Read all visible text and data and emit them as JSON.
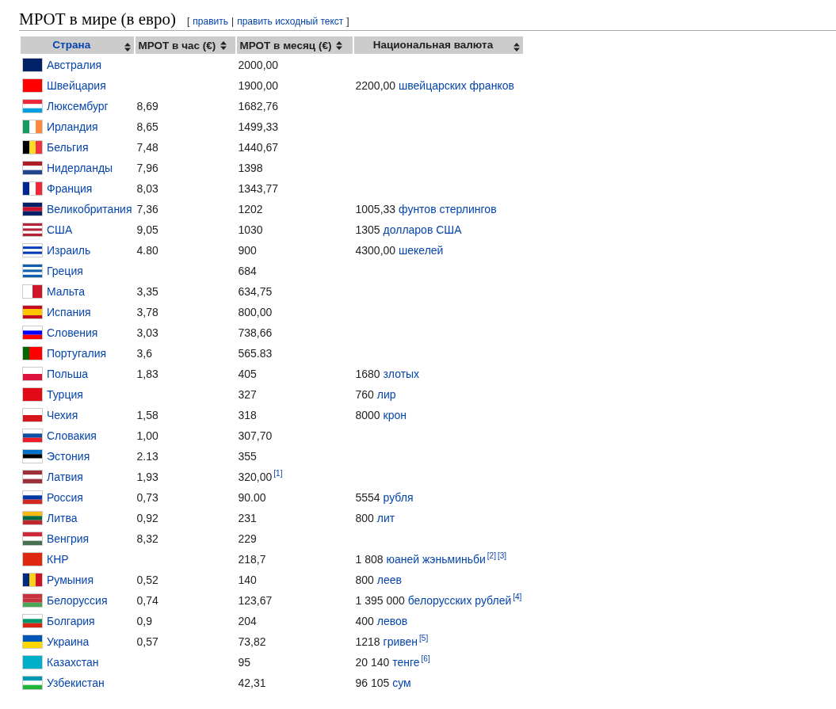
{
  "heading": "МРОТ в мире (в евро)",
  "edit_links": {
    "open": "[",
    "items": [
      "править",
      "править исходный текст"
    ],
    "separator": "|",
    "close": "]"
  },
  "table": {
    "columns": [
      {
        "label": "Страна",
        "link": true
      },
      {
        "label": "МРОТ в час (€)",
        "link": false
      },
      {
        "label": "МРОТ в месяц (€)",
        "link": false
      },
      {
        "label": "Национальная валюта",
        "link": false
      }
    ],
    "rows": [
      {
        "country": "Австралия",
        "flag": {
          "kind": "horizontal",
          "stripes": [
            {
              "color": "#012169"
            }
          ]
        },
        "monthly": "2000,00"
      },
      {
        "country": "Швейцария",
        "flag": {
          "kind": "horizontal",
          "stripes": [
            {
              "color": "#ff0000"
            }
          ]
        },
        "monthly": "1900,00",
        "currency": {
          "amount": "2200,00",
          "unit": "швейцарских франков"
        }
      },
      {
        "country": "Люксембург",
        "flag": {
          "kind": "horizontal",
          "stripes": [
            {
              "color": "#ed2939"
            },
            {
              "color": "#ffffff"
            },
            {
              "color": "#00a1de"
            }
          ]
        },
        "hourly": "8,69",
        "monthly": "1682,76"
      },
      {
        "country": "Ирландия",
        "flag": {
          "kind": "vertical",
          "stripes": [
            {
              "color": "#169b62"
            },
            {
              "color": "#ffffff"
            },
            {
              "color": "#ff883e"
            }
          ]
        },
        "hourly": "8,65",
        "monthly": "1499,33"
      },
      {
        "country": "Бельгия",
        "flag": {
          "kind": "vertical",
          "stripes": [
            {
              "color": "#000000"
            },
            {
              "color": "#fdda24"
            },
            {
              "color": "#ef3340"
            }
          ]
        },
        "hourly": "7,48",
        "monthly": "1440,67"
      },
      {
        "country": "Нидерланды",
        "flag": {
          "kind": "horizontal",
          "stripes": [
            {
              "color": "#ae1c28"
            },
            {
              "color": "#ffffff"
            },
            {
              "color": "#21468b"
            }
          ]
        },
        "hourly": "7,96",
        "monthly": "1398"
      },
      {
        "country": "Франция",
        "flag": {
          "kind": "vertical",
          "stripes": [
            {
              "color": "#002395"
            },
            {
              "color": "#ffffff"
            },
            {
              "color": "#ed2939"
            }
          ]
        },
        "hourly": "8,03",
        "monthly": "1343,77"
      },
      {
        "country": "Великобритания",
        "flag": {
          "kind": "horizontal",
          "stripes": [
            {
              "color": "#012169"
            },
            {
              "color": "#c8102e"
            },
            {
              "color": "#012169"
            }
          ]
        },
        "hourly": "7,36",
        "monthly": "1202",
        "currency": {
          "amount": "1005,33",
          "unit": "фунтов стерлингов"
        }
      },
      {
        "country": "США",
        "flag": {
          "kind": "horizontal",
          "stripes": [
            {
              "color": "#b22234"
            },
            {
              "color": "#ffffff"
            },
            {
              "color": "#b22234"
            },
            {
              "color": "#ffffff"
            },
            {
              "color": "#b22234"
            }
          ]
        },
        "hourly": "9,05",
        "monthly": "1030",
        "currency": {
          "amount": "1305",
          "unit": "долларов США"
        }
      },
      {
        "country": "Израиль",
        "flag": {
          "kind": "horizontal",
          "stripes": [
            {
              "color": "#ffffff"
            },
            {
              "color": "#0038b8"
            },
            {
              "color": "#ffffff"
            },
            {
              "color": "#0038b8"
            },
            {
              "color": "#ffffff"
            }
          ]
        },
        "hourly": "4.80",
        "monthly": "900",
        "currency": {
          "amount": "4300,00",
          "unit": "шекелей"
        }
      },
      {
        "country": "Греция",
        "flag": {
          "kind": "horizontal",
          "stripes": [
            {
              "color": "#0d5eaf"
            },
            {
              "color": "#ffffff"
            },
            {
              "color": "#0d5eaf"
            },
            {
              "color": "#ffffff"
            },
            {
              "color": "#0d5eaf"
            }
          ]
        },
        "monthly": "684"
      },
      {
        "country": "Мальта",
        "flag": {
          "kind": "vertical",
          "stripes": [
            {
              "color": "#ffffff"
            },
            {
              "color": "#cf142b"
            }
          ]
        },
        "hourly": "3,35",
        "monthly": "634,75"
      },
      {
        "country": "Испания",
        "flag": {
          "kind": "horizontal",
          "stripes": [
            {
              "color": "#c60b1e"
            },
            {
              "color": "#ffc400"
            },
            {
              "color": "#ffc400"
            },
            {
              "color": "#c60b1e"
            }
          ]
        },
        "hourly": "3,78",
        "monthly": "800,00"
      },
      {
        "country": "Словения",
        "flag": {
          "kind": "horizontal",
          "stripes": [
            {
              "color": "#ffffff"
            },
            {
              "color": "#0000ff"
            },
            {
              "color": "#ff0000"
            }
          ]
        },
        "hourly": "3,03",
        "monthly": "738,66"
      },
      {
        "country": "Португалия",
        "flag": {
          "kind": "vertical",
          "stripes": [
            {
              "color": "#006600"
            },
            {
              "color": "#ff0000"
            },
            {
              "color": "#ff0000"
            }
          ]
        },
        "hourly": "3,6",
        "monthly": "565.83"
      },
      {
        "country": "Польша",
        "flag": {
          "kind": "horizontal",
          "stripes": [
            {
              "color": "#ffffff"
            },
            {
              "color": "#dc143c"
            }
          ]
        },
        "hourly": "1,83",
        "monthly": "405",
        "currency": {
          "amount": "1680",
          "unit": "злотых"
        }
      },
      {
        "country": "Турция",
        "flag": {
          "kind": "horizontal",
          "stripes": [
            {
              "color": "#e30a17"
            }
          ]
        },
        "monthly": "327",
        "currency": {
          "amount": "760",
          "unit": "лир"
        }
      },
      {
        "country": "Чехия",
        "flag": {
          "kind": "horizontal",
          "stripes": [
            {
              "color": "#ffffff"
            },
            {
              "color": "#d7141a"
            }
          ]
        },
        "hourly": "1,58",
        "monthly": "318",
        "currency": {
          "amount": "8000",
          "unit": "крон"
        }
      },
      {
        "country": "Словакия",
        "flag": {
          "kind": "horizontal",
          "stripes": [
            {
              "color": "#ffffff"
            },
            {
              "color": "#0b4ea2"
            },
            {
              "color": "#ee1c25"
            }
          ]
        },
        "hourly": "1,00",
        "monthly": "307,70"
      },
      {
        "country": "Эстония",
        "flag": {
          "kind": "horizontal",
          "stripes": [
            {
              "color": "#0072ce"
            },
            {
              "color": "#000000"
            },
            {
              "color": "#ffffff"
            }
          ]
        },
        "hourly": "2.13",
        "monthly": "355"
      },
      {
        "country": "Латвия",
        "flag": {
          "kind": "horizontal",
          "stripes": [
            {
              "color": "#9e3039"
            },
            {
              "color": "#ffffff"
            },
            {
              "color": "#9e3039"
            }
          ]
        },
        "hourly": "1,93",
        "monthly": "320,00",
        "monthly_refs": [
          "[1]"
        ]
      },
      {
        "country": "Россия",
        "flag": {
          "kind": "horizontal",
          "stripes": [
            {
              "color": "#ffffff"
            },
            {
              "color": "#0039a6"
            },
            {
              "color": "#d52b1e"
            }
          ]
        },
        "hourly": "0,73",
        "monthly": "90.00",
        "currency": {
          "amount": "5554",
          "unit": "рубля"
        }
      },
      {
        "country": "Литва",
        "flag": {
          "kind": "horizontal",
          "stripes": [
            {
              "color": "#fdb913"
            },
            {
              "color": "#006a44"
            },
            {
              "color": "#c1272d"
            }
          ]
        },
        "hourly": "0,92",
        "monthly": "231",
        "currency": {
          "amount": "800",
          "unit": "лит"
        }
      },
      {
        "country": "Венгрия",
        "flag": {
          "kind": "horizontal",
          "stripes": [
            {
              "color": "#ce2939"
            },
            {
              "color": "#ffffff"
            },
            {
              "color": "#477050"
            }
          ]
        },
        "hourly": "8,32",
        "monthly": "229"
      },
      {
        "country": "КНР",
        "flag": {
          "kind": "horizontal",
          "stripes": [
            {
              "color": "#de2910"
            }
          ]
        },
        "monthly": "218,7",
        "currency": {
          "amount": "1 808",
          "unit": "юаней жэньминьби",
          "refs": [
            "[2]",
            "[3]"
          ]
        }
      },
      {
        "country": "Румыния",
        "flag": {
          "kind": "vertical",
          "stripes": [
            {
              "color": "#002b7f"
            },
            {
              "color": "#fcd116"
            },
            {
              "color": "#ce1126"
            }
          ]
        },
        "hourly": "0,52",
        "monthly": "140",
        "currency": {
          "amount": "800",
          "unit": "леев"
        }
      },
      {
        "country": "Белоруссия",
        "flag": {
          "kind": "horizontal",
          "stripes": [
            {
              "color": "#c8313e"
            },
            {
              "color": "#c8313e"
            },
            {
              "color": "#4aa657"
            }
          ]
        },
        "hourly": "0,74",
        "monthly": "123,67",
        "currency": {
          "amount": "1 395 000",
          "unit": "белорусских рублей",
          "refs": [
            "[4]"
          ]
        }
      },
      {
        "country": "Болгария",
        "flag": {
          "kind": "horizontal",
          "stripes": [
            {
              "color": "#ffffff"
            },
            {
              "color": "#00966e"
            },
            {
              "color": "#d62612"
            }
          ]
        },
        "hourly": "0,9",
        "monthly": "204",
        "currency": {
          "amount": "400",
          "unit": "левов"
        }
      },
      {
        "country": "Украина",
        "flag": {
          "kind": "horizontal",
          "stripes": [
            {
              "color": "#0057b7"
            },
            {
              "color": "#ffd700"
            }
          ]
        },
        "hourly": "0,57",
        "monthly": "73,82",
        "currency": {
          "amount": "1218",
          "unit": "гривен",
          "refs": [
            "[5]"
          ]
        }
      },
      {
        "country": "Казахстан",
        "flag": {
          "kind": "horizontal",
          "stripes": [
            {
              "color": "#00afca"
            }
          ]
        },
        "monthly": "95",
        "currency": {
          "amount": "20 140",
          "unit": "тенге",
          "refs": [
            "[6]"
          ]
        }
      },
      {
        "country": "Узбекистан",
        "flag": {
          "kind": "horizontal",
          "stripes": [
            {
              "color": "#0099b5"
            },
            {
              "color": "#ffffff"
            },
            {
              "color": "#1eb53a"
            }
          ]
        },
        "monthly": "42,31",
        "currency": {
          "amount": "96 105",
          "unit": "сум"
        }
      }
    ]
  }
}
